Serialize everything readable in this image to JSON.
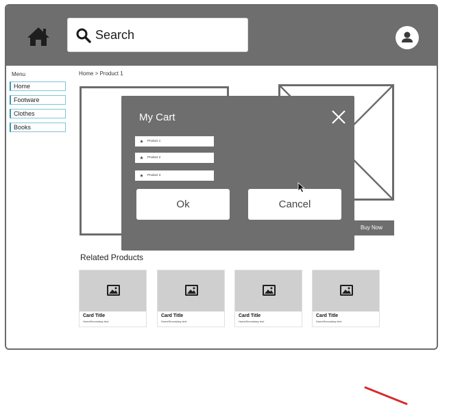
{
  "header": {
    "search_placeholder": "Search"
  },
  "sidebar": {
    "title": "Menu",
    "items": [
      {
        "label": "Home"
      },
      {
        "label": "Footware"
      },
      {
        "label": "Clothes"
      },
      {
        "label": "Books"
      }
    ]
  },
  "breadcrumb": "Home > Product 1",
  "product": {
    "buy_label": "Buy Now"
  },
  "related": {
    "title": "Related Products",
    "cards": [
      {
        "title": "Card Title",
        "subtitle": "HomeSecondary text"
      },
      {
        "title": "Card Title",
        "subtitle": "HomeSecondary text"
      },
      {
        "title": "Card Title",
        "subtitle": "HomeSecondary text"
      },
      {
        "title": "Card Title",
        "subtitle": "HomeSecondary text"
      }
    ]
  },
  "modal": {
    "title": "My Cart",
    "items": [
      {
        "label": "Product 1"
      },
      {
        "label": "Product 2"
      },
      {
        "label": "Product 3"
      }
    ],
    "ok_label": "Ok",
    "cancel_label": "Cancel"
  },
  "colors": {
    "header_bg": "#6e6e6e",
    "modal_bg": "#6e6e6e",
    "menu_border": "#7fc3d9",
    "annotation_stroke": "#d92a2a"
  },
  "icons": [
    "home-icon",
    "search-icon",
    "user-icon",
    "image-icon",
    "close-icon",
    "star-icon",
    "cursor-icon"
  ]
}
